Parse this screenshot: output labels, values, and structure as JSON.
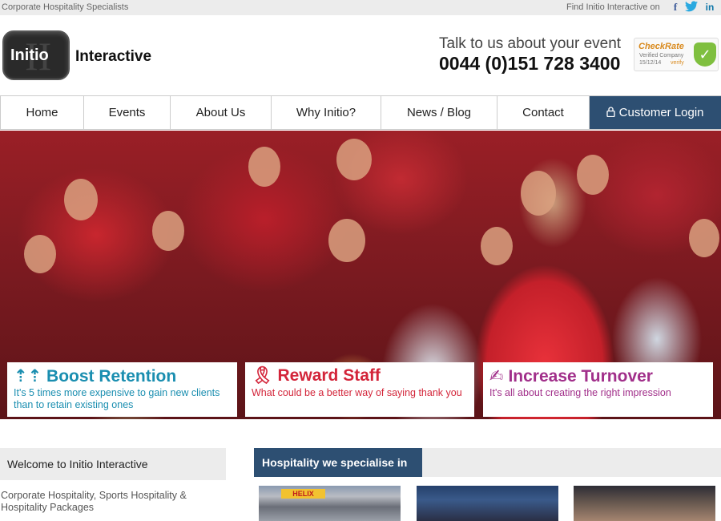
{
  "topbar": {
    "tagline": "Corporate Hospitality Specialists",
    "find_text": "Find Initio Interactive on",
    "social": [
      "facebook-icon",
      "twitter-icon",
      "linkedin-icon"
    ]
  },
  "header": {
    "logo_word": "Initio",
    "logo_mark": "II",
    "brand_second": "Interactive",
    "talk": "Talk to us about your event",
    "phone": "0044 (0)151 728 3400",
    "checkrate": {
      "title": "CheckRate",
      "subtitle": "Verified Company",
      "date": "15/12/14",
      "verify": "verify"
    }
  },
  "nav": {
    "items": [
      "Home",
      "Events",
      "About Us",
      "Why Initio?",
      "News / Blog",
      "Contact"
    ],
    "login": "Customer Login"
  },
  "features": [
    {
      "title": "Boost Retention",
      "desc": "It's 5 times more expensive to gain new clients than to retain existing ones",
      "icon": "people-up-icon",
      "color": "#1a8eb0"
    },
    {
      "title": "Reward Staff",
      "desc": "What could be a better way of saying thank you",
      "icon": "ribbon-icon",
      "color": "#d3253a"
    },
    {
      "title": "Increase Turnover",
      "desc": "It's all about creating the right impression",
      "icon": "hand-money-icon",
      "color": "#a12f8a"
    }
  ],
  "welcome": {
    "heading": "Welcome to Initio Interactive",
    "intro": "Corporate Hospitality, Sports Hospitality & Hospitality Packages"
  },
  "specialise": {
    "heading": "Hospitality we specialise in",
    "thumb1_tag": "HELIX"
  },
  "colors": {
    "nav_login_bg": "#2d4f72",
    "topbar_bg": "#ececec"
  }
}
